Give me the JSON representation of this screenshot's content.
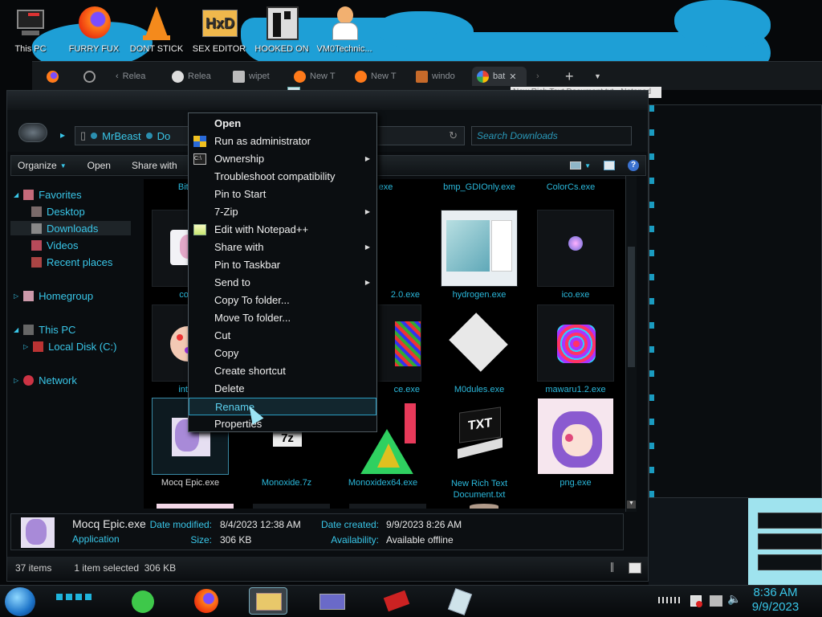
{
  "desktop": {
    "icons": [
      {
        "label": "This PC"
      },
      {
        "label": "FURRY FUX"
      },
      {
        "label": "DONT STICK"
      },
      {
        "label": "SEX EDITOR"
      },
      {
        "label": "HOOKED ON"
      },
      {
        "label": "VM0Technic..."
      }
    ]
  },
  "browser": {
    "tabs": [
      {
        "label": "Relea"
      },
      {
        "label": "Relea"
      },
      {
        "label": "wipet"
      },
      {
        "label": "New T"
      },
      {
        "label": "New T"
      },
      {
        "label": "windo"
      },
      {
        "label": "bat"
      }
    ],
    "new_tab": "+",
    "tooltip": "New Rich Text Document.txt - Notepad"
  },
  "explorer": {
    "breadcrumb": [
      "MrBeast",
      "Do"
    ],
    "search_placeholder": "Search Downloads",
    "toolbar": {
      "organize": "Organize",
      "open": "Open",
      "share_with": "Share with"
    },
    "nav": {
      "favorites": "Favorites",
      "desktop": "Desktop",
      "downloads": "Downloads",
      "videos": "Videos",
      "recent": "Recent places",
      "homegroup": "Homegroup",
      "this_pc": "This PC",
      "local_disk": "Local Disk (C:)",
      "network": "Network"
    },
    "top_row": [
      "Bitmap",
      ".exe",
      "bmp_GDIOnly.exe",
      "ColorCs.exe"
    ],
    "files": [
      {
        "name": "coore"
      },
      {
        "name": "2.0.exe"
      },
      {
        "name": "hydrogen.exe"
      },
      {
        "name": "ico.exe"
      },
      {
        "name": "intdus"
      },
      {
        "name": "ce.exe"
      },
      {
        "name": "M0dules.exe"
      },
      {
        "name": "mawaru1.2.exe"
      },
      {
        "name": "Mocq Epic.exe"
      },
      {
        "name": "Monoxide.7z"
      },
      {
        "name": "Monoxidex64.exe"
      },
      {
        "name": "New Rich Text Document.txt"
      },
      {
        "name": "png.exe"
      }
    ],
    "details": {
      "name": "Mocq Epic.exe",
      "type": "Application",
      "modified_label": "Date modified:",
      "modified": "8/4/2023 12:38 AM",
      "size_label": "Size:",
      "size": "306 KB",
      "created_label": "Date created:",
      "created": "9/9/2023 8:26 AM",
      "availability_label": "Availability:",
      "availability": "Available offline"
    },
    "status": {
      "items": "37 items",
      "selected": "1 item selected  306 KB"
    }
  },
  "context_menu": {
    "items": [
      {
        "label": "Open"
      },
      {
        "label": "Run as administrator"
      },
      {
        "label": "Ownership"
      },
      {
        "label": "Troubleshoot compatibility"
      },
      {
        "label": "Pin to Start"
      },
      {
        "label": "7-Zip"
      },
      {
        "label": "Edit with Notepad++"
      },
      {
        "label": "Share with"
      },
      {
        "label": "Pin to Taskbar"
      },
      {
        "label": "Send to"
      },
      {
        "label": "Copy To folder..."
      },
      {
        "label": "Move To folder..."
      },
      {
        "label": "Cut"
      },
      {
        "label": "Copy"
      },
      {
        "label": "Create shortcut"
      },
      {
        "label": "Delete"
      },
      {
        "label": "Rename"
      },
      {
        "label": "Properties"
      }
    ]
  },
  "taskbar": {
    "time": "8:36 AM",
    "date": "9/9/2023"
  },
  "colors": {
    "accent": "#39c6e8",
    "highlight": "#2a9cc0",
    "background": "#000000"
  }
}
